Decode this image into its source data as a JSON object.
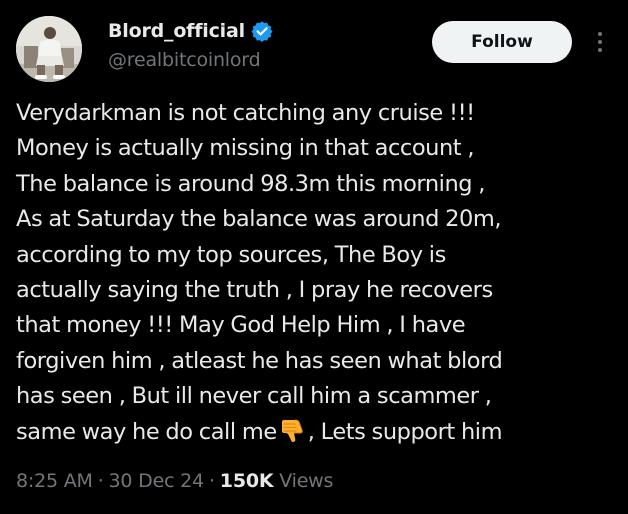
{
  "author": {
    "display_name": "Blord_official",
    "handle": "@realbitcoinlord",
    "verified": true,
    "verified_color": "#1d9bf0"
  },
  "follow_label": "Follow",
  "more_icon": "more-options-icon",
  "tweet": {
    "lines": [
      "Verydarkman is not catching any cruise !!!",
      "Money is actually missing in that account ,",
      "The balance is around 98.3m this morning ,",
      "As at Saturday the balance was around 20m,",
      "according to my top sources, The Boy is",
      "actually saying the truth , I pray he recovers",
      "that money !!! May God Help Him , I have",
      "forgiven him , atleast he  has seen what blord",
      "has seen , But ill never call him a scammer ,"
    ],
    "last_line_before_emoji": "same way he do call me",
    "emoji_name": "thumbs-down-emoji",
    "last_line_after_emoji": ", Lets support him"
  },
  "meta": {
    "time": "8:25 AM",
    "separator": "·",
    "date": "30 Dec 24",
    "views_count": "150K",
    "views_label": "Views"
  },
  "colors": {
    "background": "#000000",
    "text": "#e7e9ea",
    "secondary": "#71767b",
    "follow_bg": "#eff3f4",
    "follow_text": "#0f1419"
  }
}
